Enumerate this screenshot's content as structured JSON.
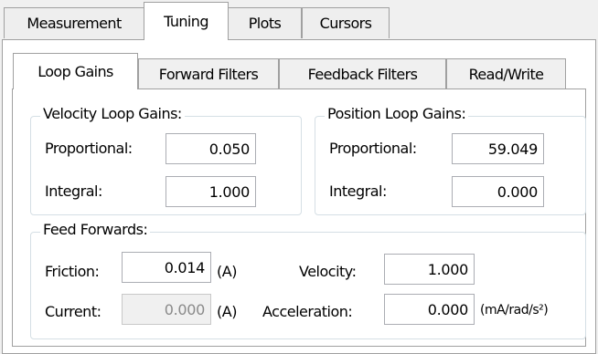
{
  "outer_tabs": [
    {
      "label": "Measurement"
    },
    {
      "label": "Tuning"
    },
    {
      "label": "Plots"
    },
    {
      "label": "Cursors"
    }
  ],
  "inner_tabs": [
    {
      "label": "Loop Gains"
    },
    {
      "label": "Forward Filters"
    },
    {
      "label": "Feedback Filters"
    },
    {
      "label": "Read/Write"
    }
  ],
  "velocity": {
    "title": "Velocity Loop Gains:",
    "proportional_label": "Proportional:",
    "proportional_value": "0.050",
    "integral_label": "Integral:",
    "integral_value": "1.000"
  },
  "position": {
    "title": "Position Loop Gains:",
    "proportional_label": "Proportional:",
    "proportional_value": "59.049",
    "integral_label": "Integral:",
    "integral_value": "0.000"
  },
  "feed_forwards": {
    "title": "Feed Forwards:",
    "friction_label": "Friction:",
    "friction_value": "0.014",
    "friction_unit": "(A)",
    "current_label": "Current:",
    "current_value": "0.000",
    "current_unit": "(A)",
    "velocity_label": "Velocity:",
    "velocity_value": "1.000",
    "acceleration_label": "Acceleration:",
    "acceleration_value": "0.000",
    "acceleration_unit": "(mA/rad/s²)"
  }
}
